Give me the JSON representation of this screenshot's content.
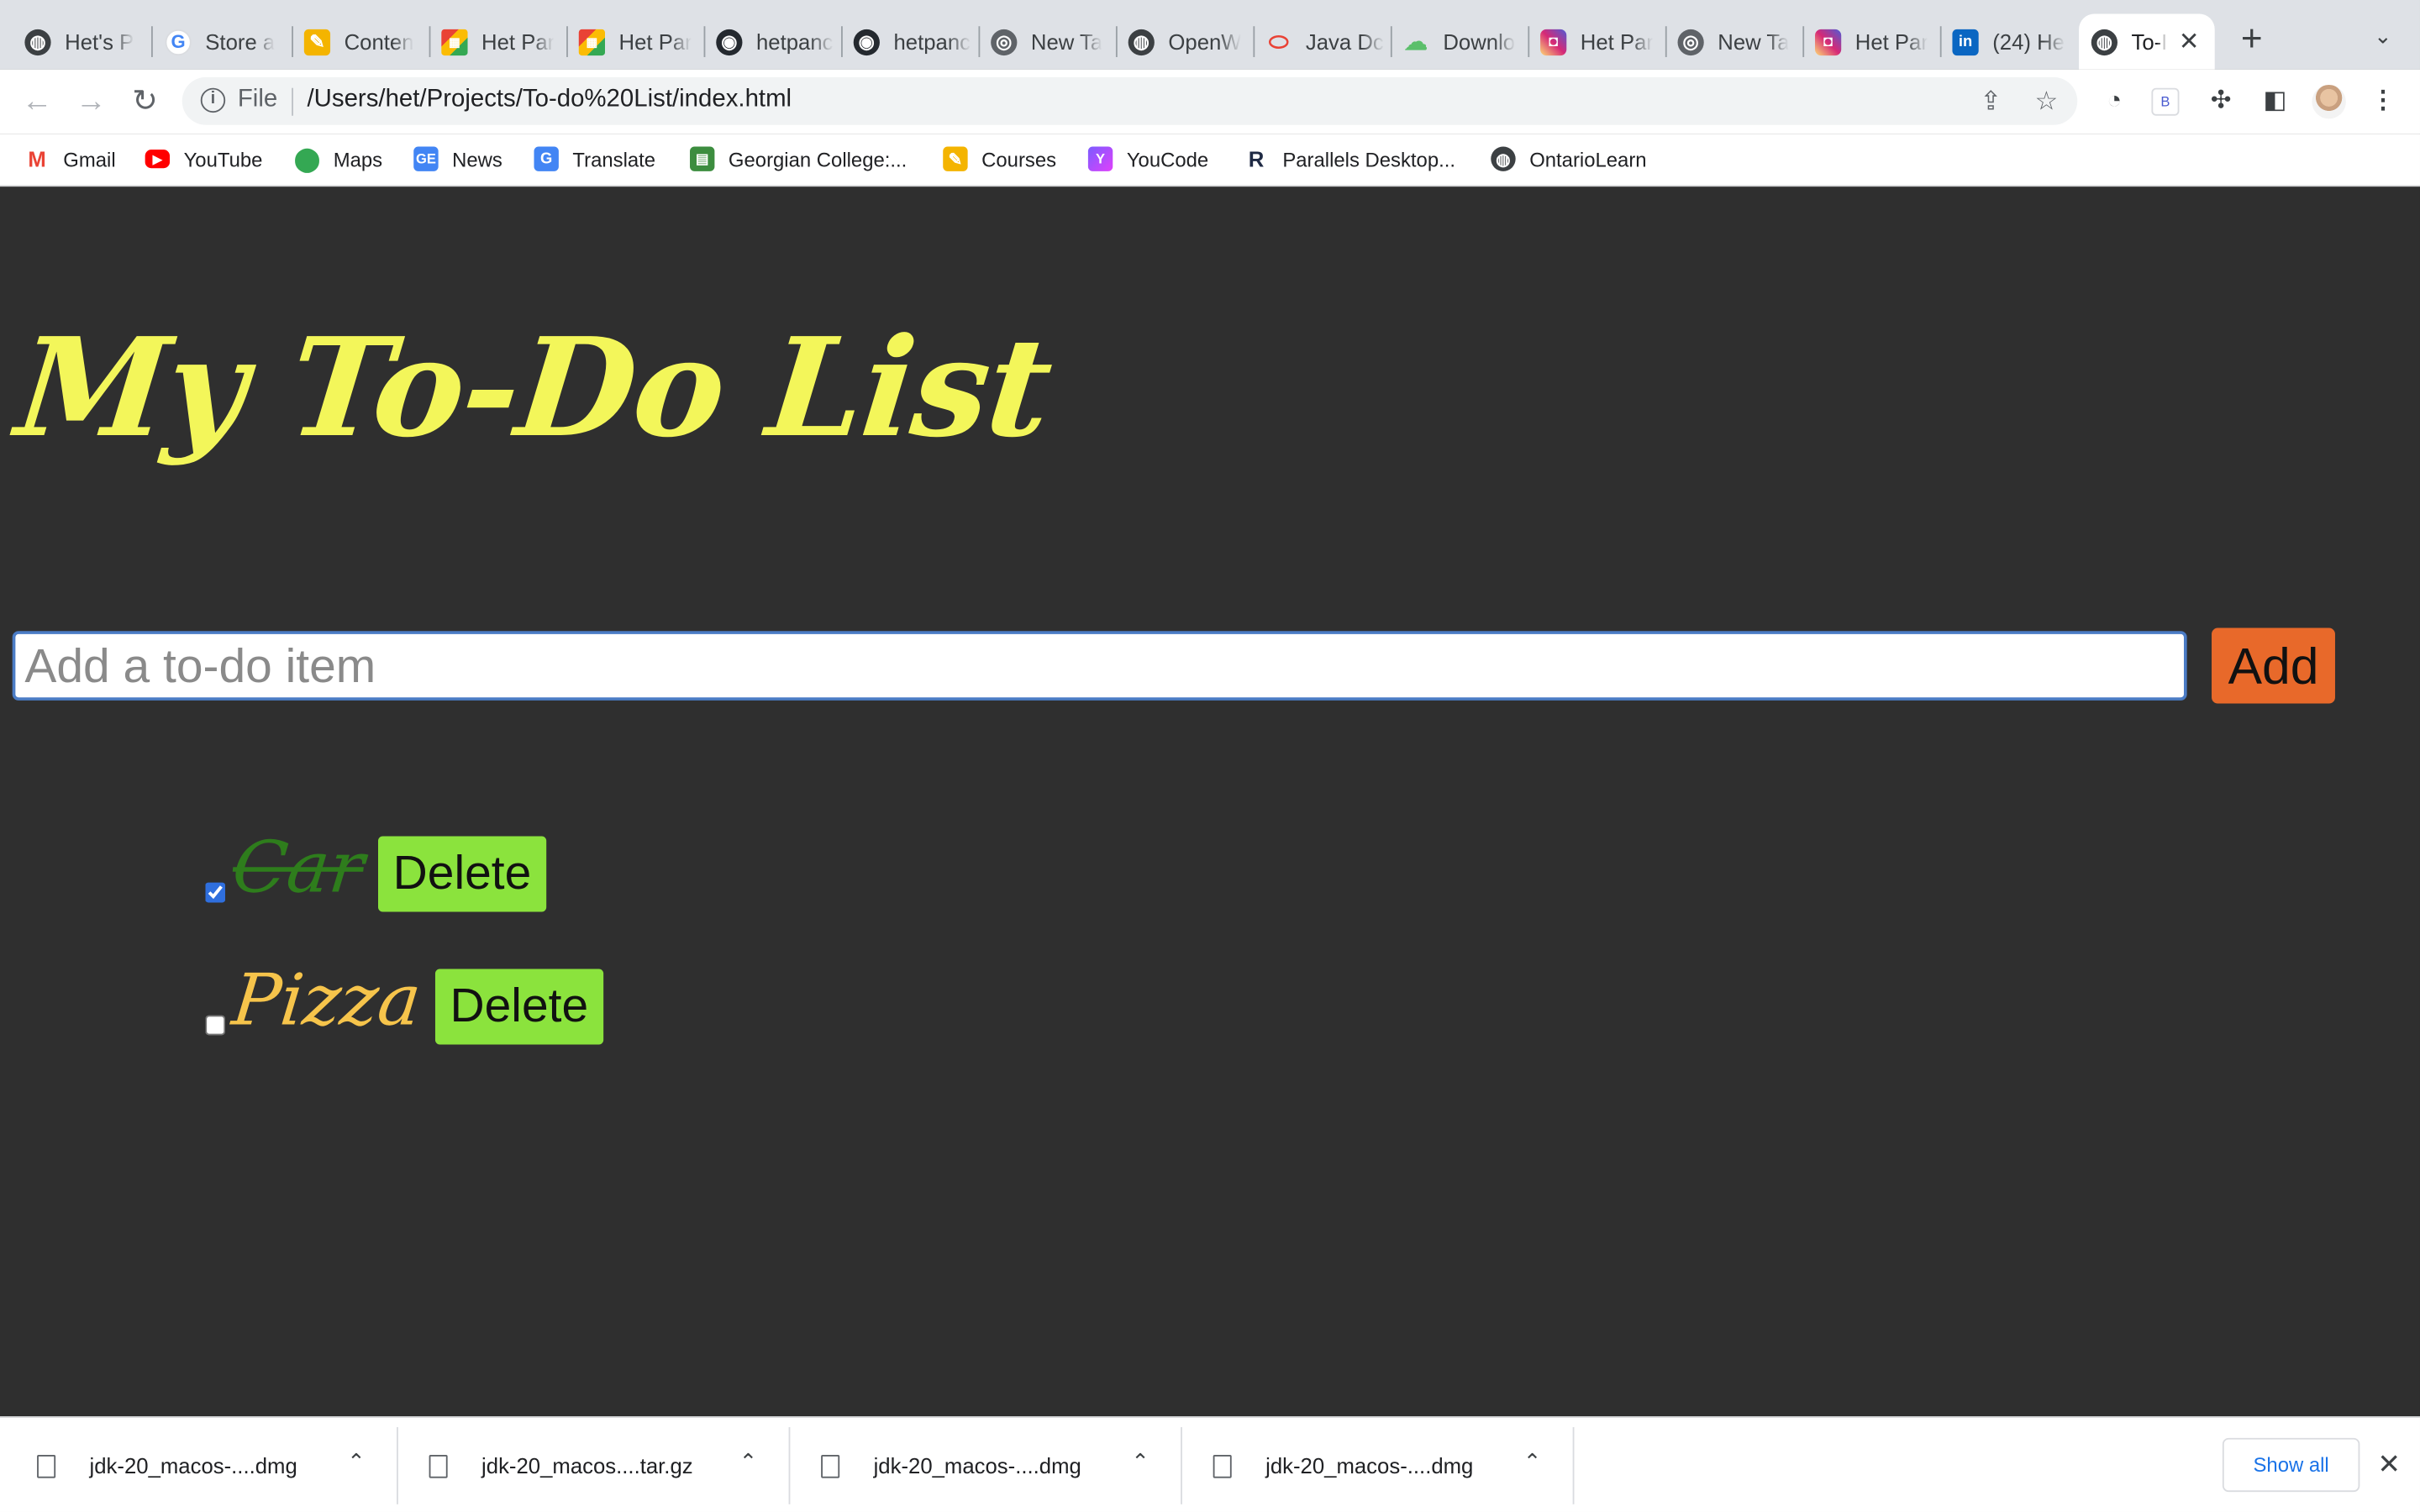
{
  "tabs": [
    {
      "label": "Het's P",
      "icon": "globe-icon"
    },
    {
      "label": "Store a",
      "icon": "google-icon"
    },
    {
      "label": "Conten",
      "icon": "pencil-icon"
    },
    {
      "label": "Het Par",
      "icon": "grid-logo-icon"
    },
    {
      "label": "Het Par",
      "icon": "grid-logo-icon"
    },
    {
      "label": "hetpanc",
      "icon": "github-icon"
    },
    {
      "label": "hetpanc",
      "icon": "github-icon"
    },
    {
      "label": "New Ta",
      "icon": "chrome-icon"
    },
    {
      "label": "OpenW",
      "icon": "globe-icon"
    },
    {
      "label": "Java Dc",
      "icon": "oracle-icon"
    },
    {
      "label": "Downlo",
      "icon": "cloud-icon"
    },
    {
      "label": "Het Par",
      "icon": "instagram-icon"
    },
    {
      "label": "New Ta",
      "icon": "chrome-icon"
    },
    {
      "label": "Het Par",
      "icon": "instagram-icon"
    },
    {
      "label": "(24) He",
      "icon": "linkedin-icon"
    },
    {
      "label": "To-I",
      "icon": "globe-icon",
      "active": true
    }
  ],
  "toolbar": {
    "scheme_label": "File",
    "url": "/Users/het/Projects/To-do%20List/index.html"
  },
  "bookmarks": [
    {
      "label": "Gmail",
      "icon": "gmail-icon"
    },
    {
      "label": "YouTube",
      "icon": "youtube-icon"
    },
    {
      "label": "Maps",
      "icon": "maps-icon"
    },
    {
      "label": "News",
      "icon": "news-icon"
    },
    {
      "label": "Translate",
      "icon": "translate-icon"
    },
    {
      "label": "Georgian College:...",
      "icon": "georgian-icon"
    },
    {
      "label": "Courses",
      "icon": "courses-icon"
    },
    {
      "label": "YouCode",
      "icon": "youcode-icon"
    },
    {
      "label": "Parallels Desktop...",
      "icon": "parallels-icon"
    },
    {
      "label": "OntarioLearn",
      "icon": "globe-icon"
    }
  ],
  "page": {
    "heading": "My To-Do List",
    "input_placeholder": "Add a to-do item",
    "add_label": "Add",
    "delete_label": "Delete",
    "items": [
      {
        "text": "Car",
        "done": true
      },
      {
        "text": "Pizza",
        "done": false
      }
    ]
  },
  "downloads": {
    "files": [
      {
        "name": "jdk-20_macos-....dmg"
      },
      {
        "name": "jdk-20_macos....tar.gz"
      },
      {
        "name": "jdk-20_macos-....dmg"
      },
      {
        "name": "jdk-20_macos-....dmg"
      }
    ],
    "show_all_label": "Show all"
  },
  "colors": {
    "page_bg": "#2f2f2f",
    "heading": "#f3f65a",
    "add_button": "#e8692a",
    "delete_button": "#8be33d",
    "done_text": "#2e7d1c",
    "open_text": "#f6c44b"
  }
}
